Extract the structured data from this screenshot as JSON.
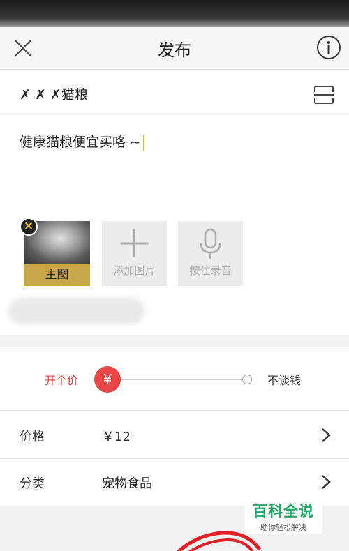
{
  "nav": {
    "title": "发布",
    "close_icon": "close-icon",
    "info_icon": "info-icon"
  },
  "post": {
    "title_prefix": "✗ ✗ ✗",
    "title_rest": "猫粮",
    "scan_icon": "scan-icon",
    "description": "健康猫粮便宜买咯 ~"
  },
  "media": {
    "main_image_label": "主图",
    "add_image_label": "添加图片",
    "record_label": "按住录音"
  },
  "pricing_mode": {
    "left": "开个价",
    "knob": "¥",
    "right": "不谈钱",
    "selected": "开个价"
  },
  "fields": [
    {
      "key": "价格",
      "value": "￥12"
    },
    {
      "key": "分类",
      "value": "宠物食品"
    }
  ],
  "watermark": {
    "title": "百科全说",
    "subtitle": "助你轻松解决"
  },
  "colors": {
    "accent_red": "#e84545",
    "watermark_green": "#20a864",
    "main_image_band": "#c8a64a"
  }
}
